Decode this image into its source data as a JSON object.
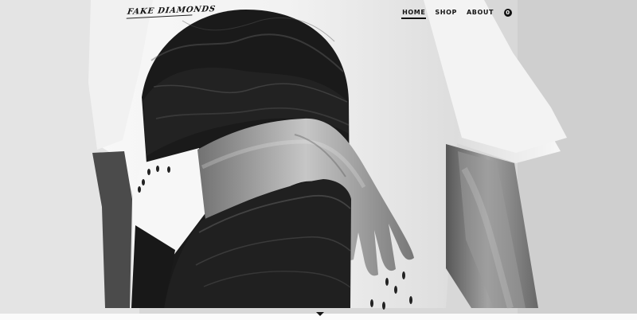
{
  "brand": {
    "logo_text": "FAKE DIAMONDS"
  },
  "nav": {
    "items": [
      {
        "label": "HOME",
        "active": true
      },
      {
        "label": "SHOP",
        "active": false
      },
      {
        "label": "ABOUT",
        "active": false
      }
    ],
    "cart_count": "0"
  },
  "hero": {
    "image": "person wearing printed t-shirt",
    "colors": {
      "wall": "#d9d9d9",
      "shirt": "#f4f4f4",
      "print_dark": "#171717",
      "skin": "#8a8a8a"
    }
  },
  "slider": {
    "indicator_icon": "down-pointer-icon"
  }
}
